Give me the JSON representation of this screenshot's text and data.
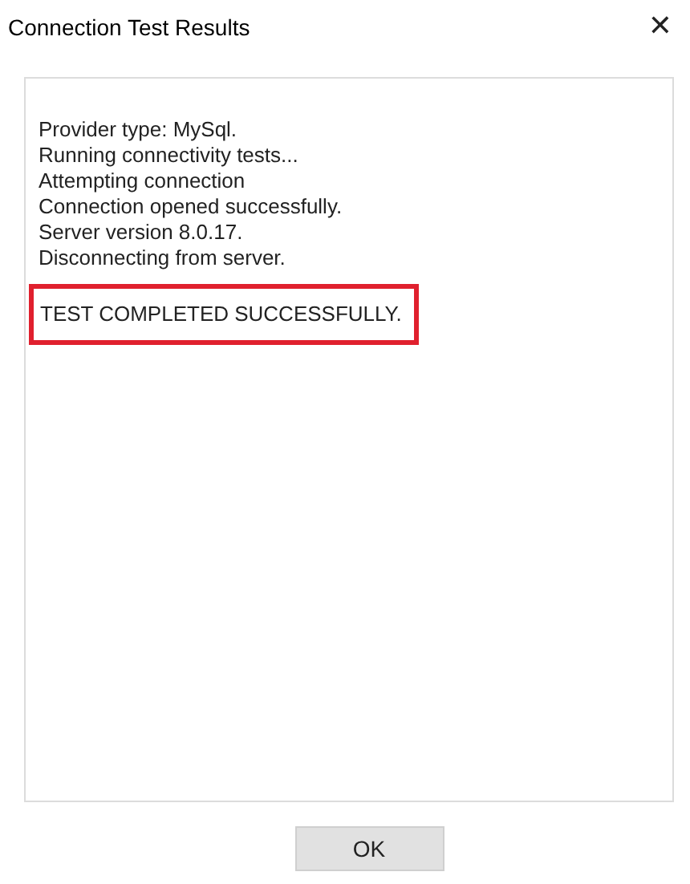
{
  "window": {
    "title": "Connection Test Results",
    "close": "✕"
  },
  "results": {
    "lines": [
      {
        "text": "Provider type: MySql.",
        "highlighted": false
      },
      {
        "text": "Running connectivity tests...",
        "highlighted": false
      },
      {
        "text": "Attempting connection",
        "highlighted": false
      },
      {
        "text": "Connection opened successfully.",
        "highlighted": false
      },
      {
        "text": "Server version 8.0.17.",
        "highlighted": false
      },
      {
        "text": "Disconnecting from server.",
        "highlighted": false
      },
      {
        "text": "TEST COMPLETED SUCCESSFULLY.",
        "highlighted": true
      }
    ]
  },
  "buttons": [
    "OK"
  ]
}
